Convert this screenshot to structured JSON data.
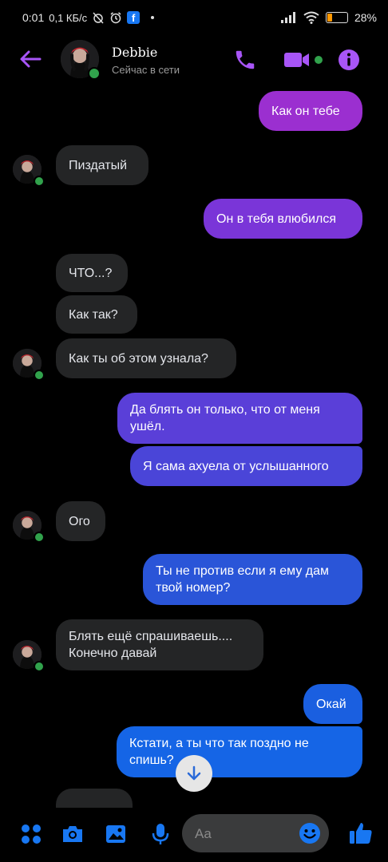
{
  "status_bar": {
    "time": "0:01",
    "net_speed": "0,1 КБ/с",
    "battery": "28%",
    "battery_fraction": 0.28
  },
  "header": {
    "contact_name": "Debbie",
    "contact_status": "Сейчас в сети"
  },
  "messages": {
    "m1": "Как он тебе",
    "m2": "Пиздатый",
    "m3": "Он в тебя влюбился",
    "m4": "ЧТО...?",
    "m5": "Как так?",
    "m6": "Как ты об этом узнала?",
    "m7": "Да блять он только, что от меня ушёл.",
    "m8": "Я сама ахуела от услышанного",
    "m9": "Ого",
    "m10": "Ты не против если я ему дам твой номер?",
    "m11": "Блять ещё спрашиваешь.... Конечно давай",
    "m12": "Окай",
    "m13": "Кстати, а ты что так поздно не спишь?"
  },
  "composer": {
    "placeholder": "Aa"
  },
  "colors": {
    "accent": "#a855f7",
    "online": "#31a24c",
    "received_bubble": "#242526"
  },
  "icons": [
    "back-arrow-icon",
    "phone-icon",
    "video-camera-icon",
    "info-icon",
    "menu-dots-icon",
    "camera-icon",
    "image-icon",
    "microphone-icon",
    "emoji-icon",
    "thumbs-up-icon",
    "arrow-down-icon"
  ]
}
